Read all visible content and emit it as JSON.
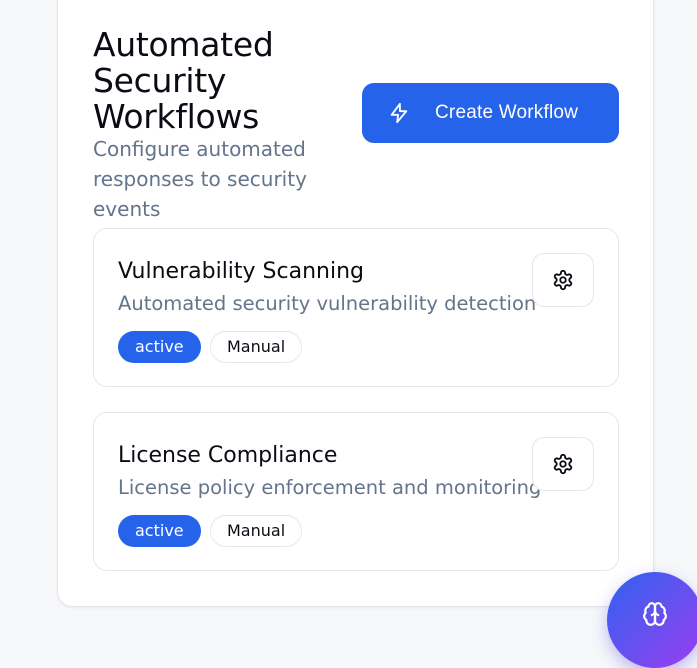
{
  "header": {
    "title": "Automated Security Workflows",
    "subtitle": "Configure automated responses to security events",
    "create_button": {
      "label": "Create Workflow",
      "icon": "lightning-bolt-icon"
    }
  },
  "workflows": [
    {
      "name": "Vulnerability Scanning",
      "description": "Automated security vulnerability detection",
      "status": "active",
      "trigger": "Manual",
      "settings_icon": "gear-icon"
    },
    {
      "name": "License Compliance",
      "description": "License policy enforcement and monitoring",
      "status": "active",
      "trigger": "Manual",
      "settings_icon": "gear-icon"
    }
  ],
  "fab": {
    "icon": "brain-icon"
  },
  "colors": {
    "accent": "#2563eb",
    "muted_text": "#64748b",
    "fab_gradient_start": "#2f62f0",
    "fab_gradient_end": "#9b3cf0"
  }
}
